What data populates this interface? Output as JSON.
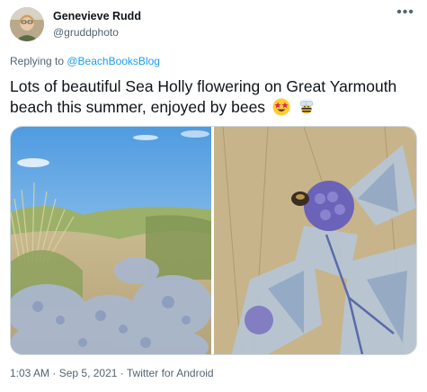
{
  "author": {
    "name": "Genevieve Rudd",
    "handle": "@gruddphoto"
  },
  "more_icon": "•••",
  "reply": {
    "prefix": "Replying to ",
    "to": "@BeachBooksBlog"
  },
  "tweet": {
    "text": "Lots of beautiful Sea Holly flowering on Great Yarmouth beach this summer, enjoyed by bees",
    "emojis": [
      "star-struck-emoji",
      "bee-emoji"
    ]
  },
  "meta": {
    "time": "1:03 AM",
    "sep1": " · ",
    "date": "Sep 5, 2021",
    "sep2": " · ",
    "source": "Twitter for Android"
  },
  "colors": {
    "link": "#1d9bf0",
    "secondary_text": "#536471",
    "border": "#cfd9de"
  }
}
